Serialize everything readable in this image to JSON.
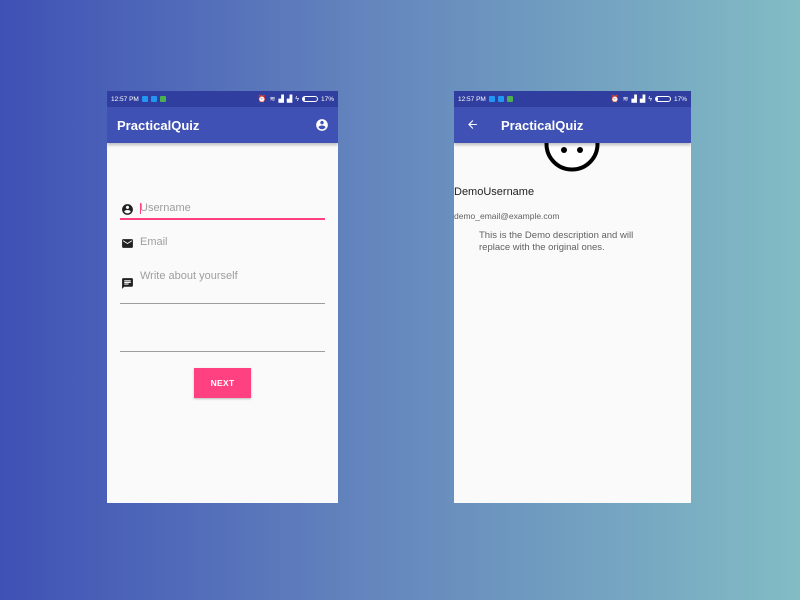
{
  "status_bar": {
    "time": "12:57 PM",
    "battery_percent": "17%",
    "battery_level": 0.17,
    "notification_icons": [
      {
        "name": "notif-icon-1",
        "color": "#2196f3"
      },
      {
        "name": "notif-icon-2",
        "color": "#2196f3"
      },
      {
        "name": "notif-icon-3",
        "color": "#4caf50"
      }
    ]
  },
  "colors": {
    "primary": "#3f51b5",
    "primary_dark": "#303f9f",
    "accent": "#ff4081",
    "background": "#fafafa"
  },
  "login_screen": {
    "app_title": "PracticalQuiz",
    "header_icon": "account-circle-icon",
    "fields": [
      {
        "name": "username-input",
        "icon": "account-circle-icon",
        "placeholder": "Username",
        "value": "",
        "focused": true
      },
      {
        "name": "email-input",
        "icon": "email-icon",
        "placeholder": "Email",
        "value": ""
      },
      {
        "name": "about-input",
        "icon": "message-icon",
        "placeholder": "Write about yourself",
        "value": ""
      }
    ],
    "next_button_label": "NEXT"
  },
  "profile_screen": {
    "app_title": "PracticalQuiz",
    "back_icon": "arrow-back-icon",
    "avatar_icon": "face-icon",
    "username": "DemoUsername",
    "email": "demo_email@example.com",
    "description": "This is the Demo description and will replace with the original ones."
  }
}
